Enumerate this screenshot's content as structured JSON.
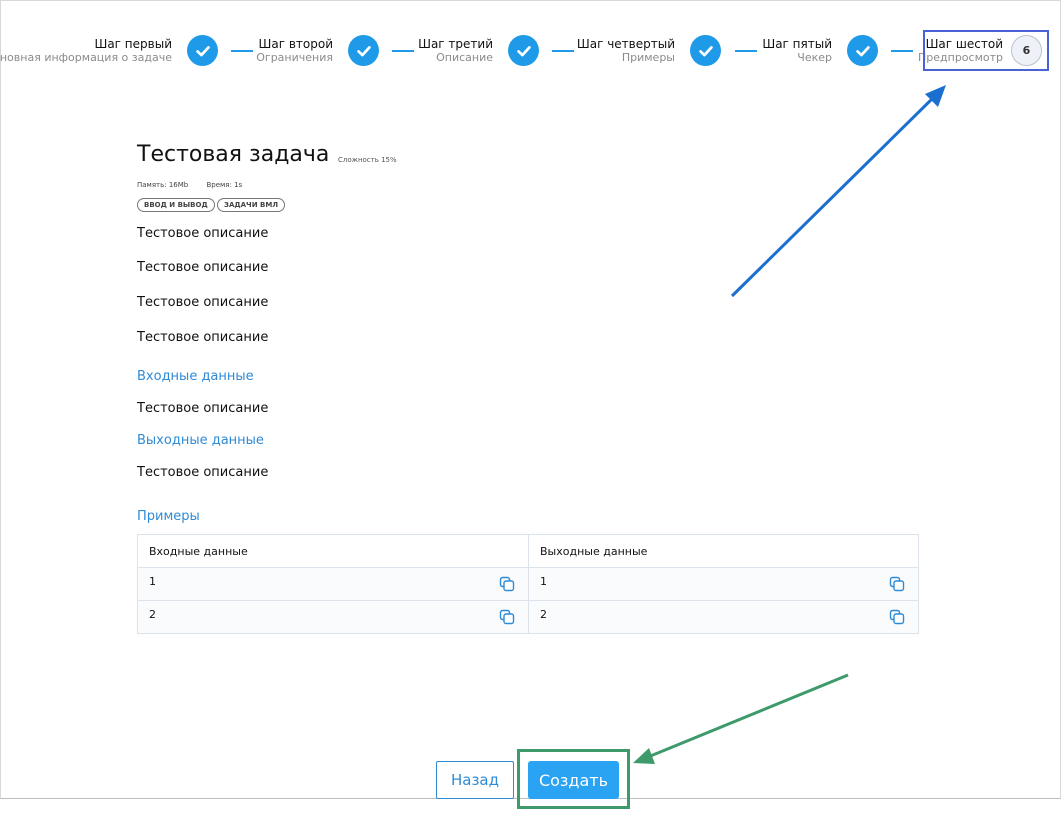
{
  "stepper": [
    {
      "title": "Шаг первый",
      "subtitle": "Основная информация о задаче",
      "state": "done"
    },
    {
      "title": "Шаг второй",
      "subtitle": "Ограничения",
      "state": "done"
    },
    {
      "title": "Шаг третий",
      "subtitle": "Описание",
      "state": "done"
    },
    {
      "title": "Шаг четвертый",
      "subtitle": "Примеры",
      "state": "done"
    },
    {
      "title": "Шаг пятый",
      "subtitle": "Чекер",
      "state": "done"
    },
    {
      "title": "Шаг шестой",
      "subtitle": "Предпросмотр",
      "state": "current",
      "number": "6"
    }
  ],
  "task": {
    "title": "Тестовая задача",
    "difficulty": "Сложность 15%",
    "memory": "Память: 16Mb",
    "time": "Время: 1s",
    "tags": [
      "ВВОД И ВЫВОД",
      "ЗАДАЧИ ВМЛ"
    ],
    "description": [
      "Тестовое описание",
      "Тестовое описание",
      "Тестовое описание",
      "Тестовое описание"
    ],
    "input_heading": "Входные данные",
    "input_text": "Тестовое описание",
    "output_heading": "Выходные данные",
    "output_text": "Тестовое описание",
    "examples_heading": "Примеры"
  },
  "examples": {
    "headers": [
      "Входные данные",
      "Выходные данные"
    ],
    "rows": [
      [
        "1",
        "1"
      ],
      [
        "2",
        "2"
      ]
    ]
  },
  "buttons": {
    "back": "Назад",
    "create": "Создать"
  },
  "colors": {
    "accent": "#1f9ae8",
    "highlight_blue": "#4a62d8",
    "highlight_green": "#3e9a6b",
    "section_text": "#2f8bd6"
  }
}
